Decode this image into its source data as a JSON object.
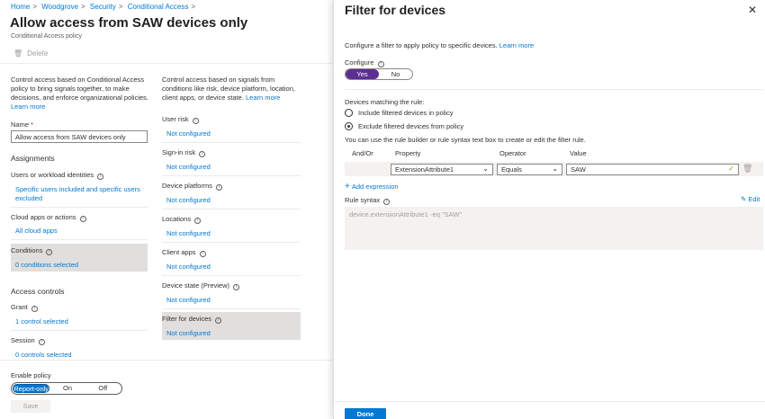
{
  "breadcrumb": [
    "Home",
    "Woodgrove",
    "Security",
    "Conditional Access"
  ],
  "page": {
    "title": "Allow access from SAW devices only",
    "subtitle": "Conditional Access policy",
    "delete_label": "Delete"
  },
  "left_desc": "Control access based on Conditional Access policy to bring signals together, to make decisions, and enforce organizational policies.",
  "left_desc_link": "Learn more",
  "name_label": "Name",
  "name_value": "Allow access from SAW devices only",
  "assignments": {
    "heading": "Assignments",
    "users_label": "Users or workload identities",
    "users_value": "Specific users included and specific users excluded",
    "apps_label": "Cloud apps or actions",
    "apps_value": "All cloud apps",
    "conditions_label": "Conditions",
    "conditions_value": "0 conditions selected"
  },
  "access_controls": {
    "heading": "Access controls",
    "grant_label": "Grant",
    "grant_value": "1 control selected",
    "session_label": "Session",
    "session_value": "0 controls selected"
  },
  "enable_policy": {
    "label": "Enable policy",
    "options": [
      "Report-only",
      "On",
      "Off"
    ],
    "selected": "Report-only"
  },
  "save_label": "Save",
  "conditions_desc": "Control access based on signals from conditions like risk, device platform, location, client apps, or device state.",
  "conditions_desc_link": "Learn more",
  "conditions": [
    {
      "label": "User risk",
      "value": "Not configured"
    },
    {
      "label": "Sign-in risk",
      "value": "Not configured"
    },
    {
      "label": "Device platforms",
      "value": "Not configured"
    },
    {
      "label": "Locations",
      "value": "Not configured"
    },
    {
      "label": "Client apps",
      "value": "Not configured"
    },
    {
      "label": "Device state (Preview)",
      "value": "Not configured"
    },
    {
      "label": "Filter for devices",
      "value": "Not configured"
    }
  ],
  "panel": {
    "title": "Filter for devices",
    "desc": "Configure a filter to apply policy to specific devices.",
    "desc_link": "Learn more",
    "configure_label": "Configure",
    "configure_options": [
      "Yes",
      "No"
    ],
    "configure_selected": "Yes",
    "matching_label": "Devices matching the rule:",
    "include_label": "Include filtered devices in policy",
    "exclude_label": "Exclude filtered devices from policy",
    "selected_rule": "exclude",
    "builder_hint": "You can use the rule builder or rule syntax text box to create or edit the filter rule.",
    "columns": [
      "And/Or",
      "Property",
      "Operator",
      "Value"
    ],
    "row": {
      "property": "ExtensionAttribute1",
      "operator": "Equals",
      "value": "SAW"
    },
    "add_expression": "Add expression",
    "rule_syntax_label": "Rule syntax",
    "edit_label": "Edit",
    "rule_syntax_value": "device.extensionAttribute1 -eq \"SAW\"",
    "done_label": "Done"
  },
  "colors": {
    "accent": "#0078d4",
    "toggle_purple": "#5c2e91",
    "highlight": "#e1dfdd"
  }
}
